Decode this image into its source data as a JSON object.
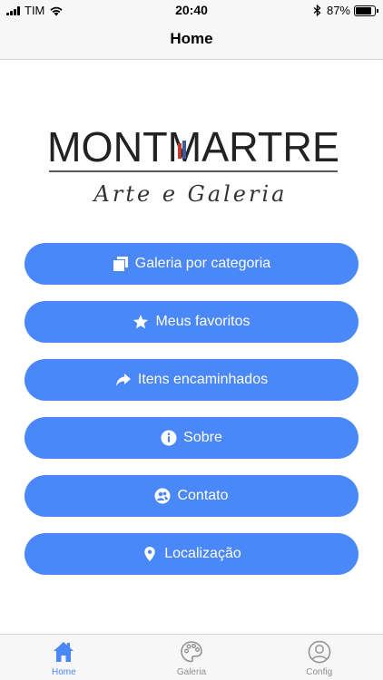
{
  "status_bar": {
    "carrier": "TIM",
    "time": "20:40",
    "battery": "87%",
    "battery_level": 0.87
  },
  "nav": {
    "title": "Home"
  },
  "logo": {
    "name": "MONTMARTRE",
    "tagline": "Arte e Galeria"
  },
  "menu": {
    "items": [
      {
        "label": "Galeria por categoria",
        "icon": "gallery-icon"
      },
      {
        "label": "Meus favoritos",
        "icon": "star-icon"
      },
      {
        "label": "Itens encaminhados",
        "icon": "share-arrow-icon"
      },
      {
        "label": "Sobre",
        "icon": "info-icon"
      },
      {
        "label": "Contato",
        "icon": "contacts-icon"
      },
      {
        "label": "Localização",
        "icon": "location-pin-icon"
      }
    ],
    "button_color": "#4a87f8"
  },
  "tab_bar": {
    "tabs": [
      {
        "label": "Home",
        "icon": "house-icon",
        "active": true
      },
      {
        "label": "Galeria",
        "icon": "palette-icon",
        "active": false
      },
      {
        "label": "Config",
        "icon": "user-icon",
        "active": false
      }
    ],
    "active_color": "#4a87f8",
    "inactive_color": "#8e8e93"
  }
}
